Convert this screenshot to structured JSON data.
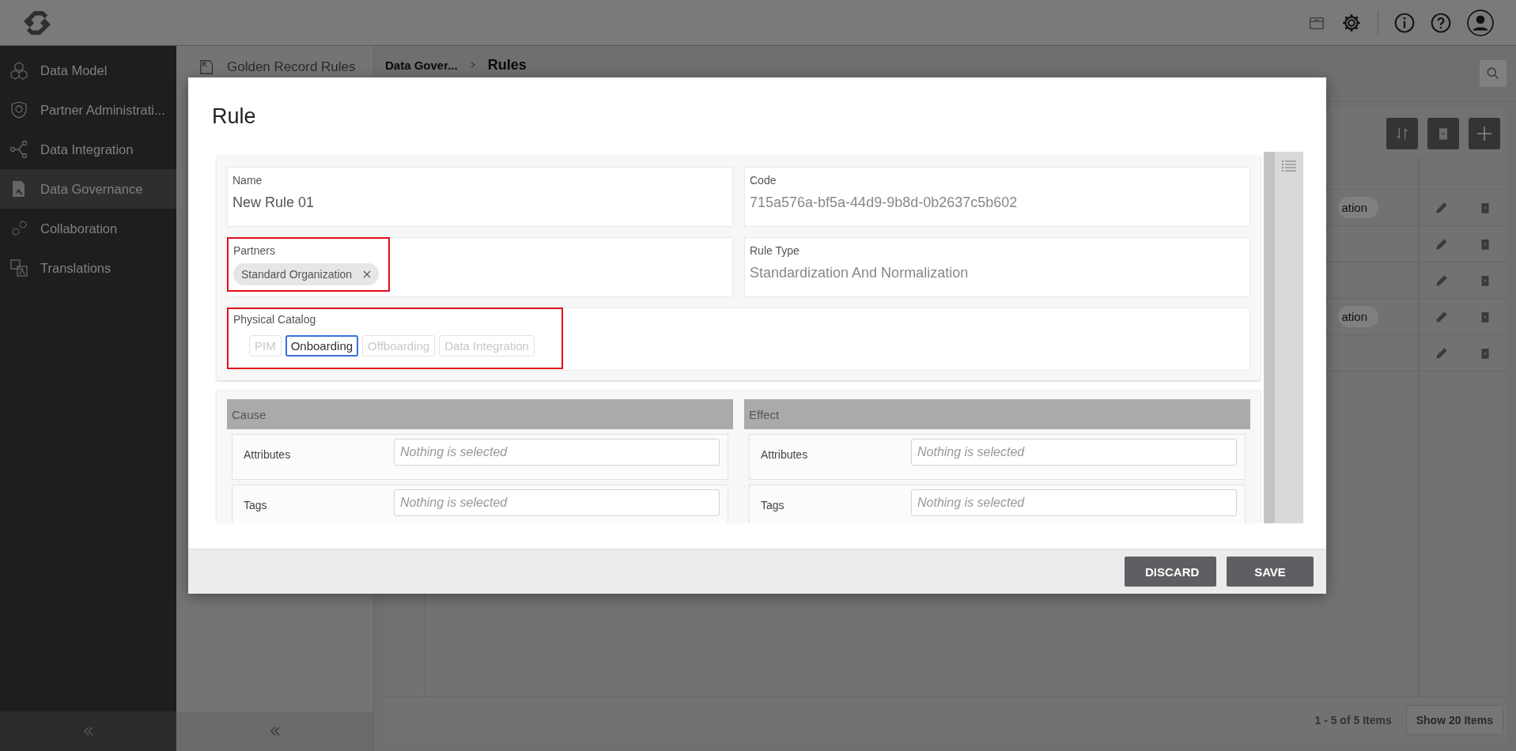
{
  "sidebar": {
    "items": [
      {
        "label": "Data Model",
        "selected": false
      },
      {
        "label": "Partner Administrati...",
        "selected": false
      },
      {
        "label": "Data Integration",
        "selected": false
      },
      {
        "label": "Data Governance",
        "selected": true
      },
      {
        "label": "Collaboration",
        "selected": false
      },
      {
        "label": "Translations",
        "selected": false
      }
    ]
  },
  "secondary_panel": {
    "title": "Golden Record Rules"
  },
  "breadcrumb": [
    {
      "label": "Data Gover..."
    },
    {
      "label": "Rules"
    }
  ],
  "table": {
    "rows": [
      {
        "tag": "ation"
      },
      {},
      {},
      {
        "tag": "ation"
      },
      {}
    ]
  },
  "pager": {
    "summary": "1 - 5 of 5 Items",
    "page_size_button": "Show 20 Items"
  },
  "modal": {
    "title": "Rule",
    "name": {
      "label": "Name",
      "value": "New Rule 01"
    },
    "code": {
      "label": "Code",
      "value": "715a576a-bf5a-44d9-9b8d-0b2637c5b602"
    },
    "partners": {
      "label": "Partners",
      "highlighted": true,
      "chips": [
        {
          "label": "Standard Organization"
        }
      ]
    },
    "rule_type": {
      "label": "Rule Type",
      "value": "Standardization And Normalization"
    },
    "physical_catalog": {
      "label": "Physical Catalog",
      "highlighted": true,
      "options": [
        {
          "label": "PIM",
          "selected": false
        },
        {
          "label": "Onboarding",
          "selected": true
        },
        {
          "label": "Offboarding",
          "selected": false
        },
        {
          "label": "Data Integration",
          "selected": false
        }
      ]
    },
    "cause": {
      "title": "Cause",
      "rows": [
        {
          "label": "Attributes",
          "placeholder": "Nothing is selected"
        },
        {
          "label": "Tags",
          "placeholder": "Nothing is selected"
        }
      ]
    },
    "effect": {
      "title": "Effect",
      "rows": [
        {
          "label": "Attributes",
          "placeholder": "Nothing is selected"
        },
        {
          "label": "Tags",
          "placeholder": "Nothing is selected"
        }
      ]
    },
    "buttons": [
      {
        "label": "DISCARD"
      },
      {
        "label": "SAVE"
      }
    ]
  }
}
